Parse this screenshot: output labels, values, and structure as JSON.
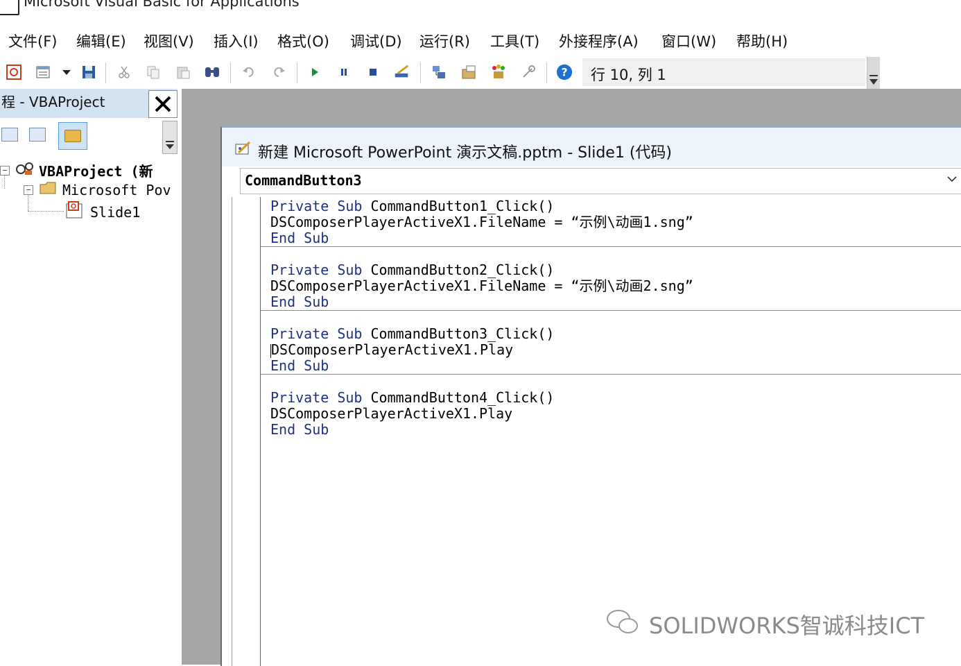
{
  "window": {
    "title": "Microsoft Visual Basic for Applications"
  },
  "menubar": {
    "items": [
      "文件(F)",
      "编辑(E)",
      "视图(V)",
      "插入(I)",
      "格式(O)",
      "调试(D)",
      "运行(R)",
      "工具(T)",
      "外接程序(A)",
      "窗口(W)",
      "帮助(H)"
    ]
  },
  "toolbar": {
    "icons": [
      "powerpoint-icon",
      "view-object-icon",
      "dropdown-icon",
      "save-icon",
      "cut-icon",
      "copy-icon",
      "paste-icon",
      "find-icon",
      "undo-icon",
      "redo-icon",
      "run-icon",
      "break-icon",
      "reset-icon",
      "design-mode-icon",
      "project-explorer-icon",
      "properties-icon",
      "object-browser-icon",
      "toolbox-icon",
      "help-icon"
    ],
    "cursor_position": "行 10, 列 1"
  },
  "project": {
    "title": "程 - VBAProject",
    "close_label": "✕",
    "tree": {
      "root": "VBAProject (新",
      "folder": "Microsoft Pov",
      "item": "Slide1"
    }
  },
  "code_window": {
    "title": "新建 Microsoft PowerPoint 演示文稿.pptm - Slide1 (代码)",
    "object_combo": "CommandButton3",
    "procedures": [
      {
        "sub_kw": "Private Sub",
        "name": " CommandButton1_Click()",
        "body": "DSComposerPlayerActiveX1.FileName = “示例\\动画1.sng”",
        "end_kw": "End Sub"
      },
      {
        "sub_kw": "Private Sub",
        "name": " CommandButton2_Click()",
        "body": "DSComposerPlayerActiveX1.FileName = “示例\\动画2.sng”",
        "end_kw": "End Sub"
      },
      {
        "sub_kw": "Private Sub",
        "name": " CommandButton3_Click()",
        "body": "DSComposerPlayerActiveX1.Play",
        "end_kw": "End Sub"
      },
      {
        "sub_kw": "Private Sub",
        "name": " CommandButton4_Click()",
        "body": "DSComposerPlayerActiveX1.Play",
        "end_kw": "End Sub"
      }
    ]
  },
  "watermark": {
    "text": "SOLIDWORKS智诚科技ICT"
  },
  "colors": {
    "keyword": "#1f2f8c",
    "mdi_background": "#a6a6a6",
    "project_header": "#d4e3f2",
    "code_title_bar": "#ecf3fb"
  }
}
